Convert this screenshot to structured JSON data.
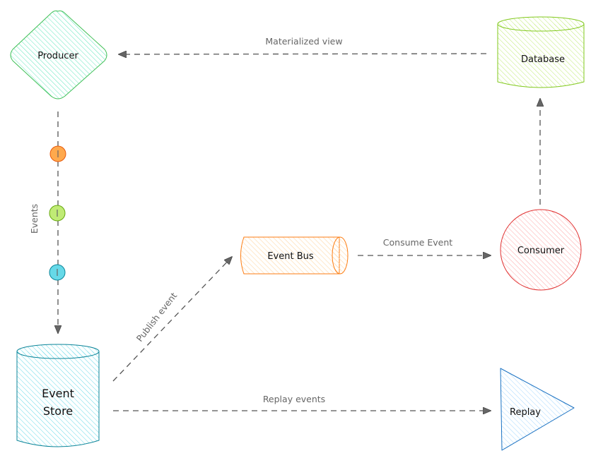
{
  "nodes": {
    "producer": {
      "label": "Producer",
      "shape": "diamond",
      "color": "#40c057"
    },
    "database": {
      "label": "Database",
      "shape": "cylinder",
      "color": "#82c91e"
    },
    "consumer": {
      "label": "Consumer",
      "shape": "circle",
      "color": "#e03131"
    },
    "event_bus": {
      "label": "Event Bus",
      "shape": "horizontal-cylinder",
      "color": "#fd7e14"
    },
    "event_store": {
      "label_line1": "Event",
      "label_line2": "Store",
      "shape": "cylinder",
      "color": "#0c8599"
    },
    "replay": {
      "label": "Replay",
      "shape": "triangle",
      "color": "#1971c2"
    }
  },
  "edges": {
    "materialized_view": {
      "label": "Materialized view",
      "from": "Database",
      "to": "Producer"
    },
    "consumer_to_database": {
      "label": "",
      "from": "Consumer",
      "to": "Database"
    },
    "consume_event": {
      "label": "Consume Event",
      "from": "Event Bus",
      "to": "Consumer"
    },
    "publish_event": {
      "label": "Publish event",
      "from": "Event Store",
      "to": "Event Bus"
    },
    "replay_events": {
      "label": "Replay events",
      "from": "Event Store",
      "to": "Replay"
    },
    "events": {
      "label": "Events",
      "from": "Producer",
      "to": "Event Store"
    }
  },
  "event_dots": [
    {
      "color": "#ffa94d"
    },
    {
      "color": "#a9e34b"
    },
    {
      "color": "#66d9e8"
    }
  ]
}
